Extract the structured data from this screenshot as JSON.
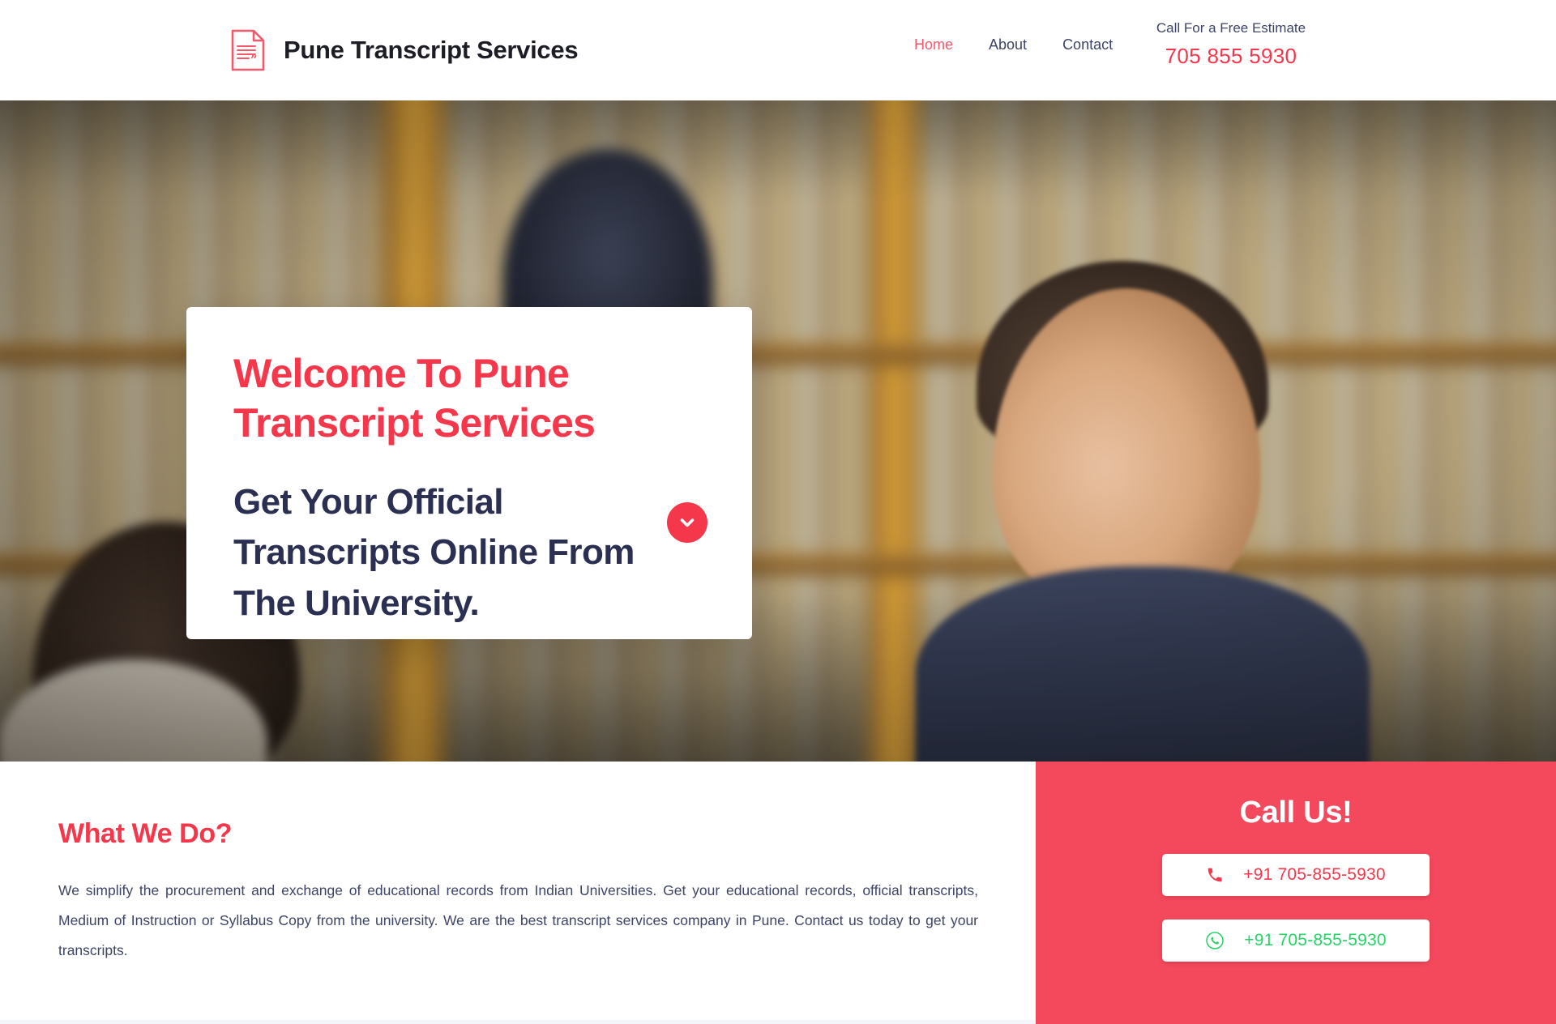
{
  "header": {
    "brand_name": "Pune Transcript Services",
    "brand_icon": "document-quote-icon",
    "nav": [
      {
        "label": "Home",
        "active": true
      },
      {
        "label": "About",
        "active": false
      },
      {
        "label": "Contact",
        "active": false
      }
    ],
    "estimate_label": "Call For a Free Estimate",
    "estimate_phone": "705 855 5930"
  },
  "hero": {
    "title": "Welcome To Pune Transcript Services",
    "subtitle": "Get Your Official Transcripts Online From The University.",
    "scroll_icon": "chevron-down-icon"
  },
  "content": {
    "heading": "What We Do?",
    "paragraph": "We simplify the procurement and exchange of educational records from Indian Universities. Get your educational records, official transcripts, Medium of Instruction or Syllabus Copy from the university. We are the best transcript services company in Pune. Contact us today to get your transcripts."
  },
  "callus": {
    "heading": "Call Us!",
    "phone_icon": "phone-icon",
    "phone_number": "+91 705-855-5930",
    "whatsapp_icon": "whatsapp-icon",
    "whatsapp_number": "+91 705-855-5930"
  },
  "colors": {
    "accent": "#f4374a",
    "panel": "#f4485c",
    "nav_active": "#f4586a",
    "dark_navy": "#2b3052",
    "whatsapp_green": "#25d366",
    "body_text": "#3d4466"
  }
}
